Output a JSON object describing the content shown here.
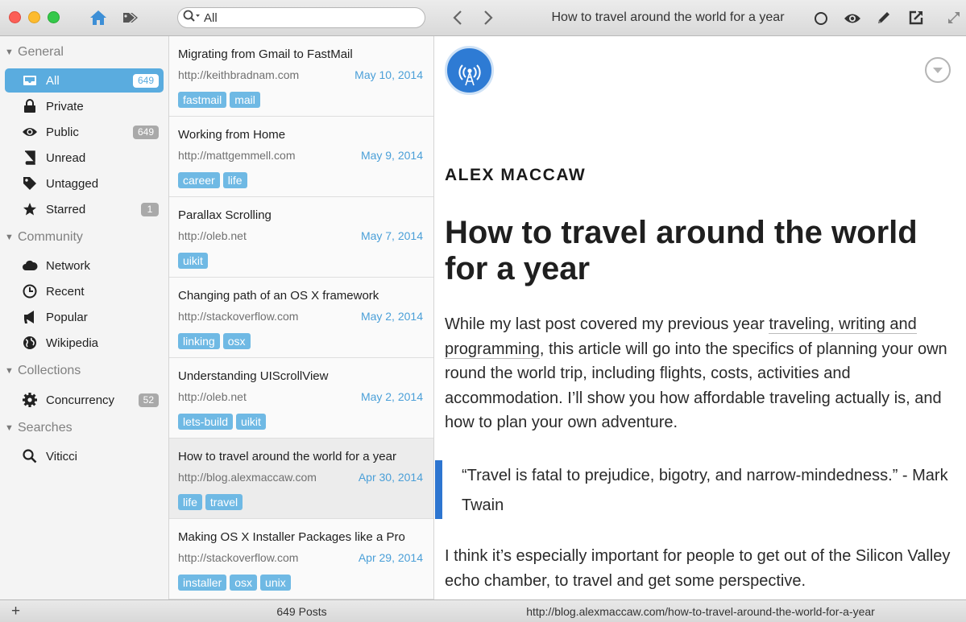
{
  "toolbar": {
    "search_placeholder": "All",
    "article_title": "How to travel around the world for a year"
  },
  "sidebar": {
    "groups": [
      {
        "label": "General"
      },
      {
        "label": "Community"
      },
      {
        "label": "Collections"
      },
      {
        "label": "Searches"
      }
    ],
    "items": [
      {
        "label": "All",
        "count": "649",
        "icon": "inbox-icon"
      },
      {
        "label": "Private",
        "count": "",
        "icon": "lock-icon"
      },
      {
        "label": "Public",
        "count": "649",
        "icon": "eye-icon"
      },
      {
        "label": "Unread",
        "count": "",
        "icon": "book-icon"
      },
      {
        "label": "Untagged",
        "count": "",
        "icon": "tag-icon"
      },
      {
        "label": "Starred",
        "count": "1",
        "icon": "star-icon"
      },
      {
        "label": "Network",
        "count": "",
        "icon": "cloud-icon"
      },
      {
        "label": "Recent",
        "count": "",
        "icon": "clock-icon"
      },
      {
        "label": "Popular",
        "count": "",
        "icon": "megaphone-icon"
      },
      {
        "label": "Wikipedia",
        "count": "",
        "icon": "globe-icon"
      },
      {
        "label": "Concurrency",
        "count": "52",
        "icon": "gear-icon"
      },
      {
        "label": "Viticci",
        "count": "",
        "icon": "search-icon"
      }
    ]
  },
  "posts": [
    {
      "title": "Migrating from Gmail to FastMail",
      "url": "http://keithbradnam.com",
      "date": "May 10, 2014",
      "tags": [
        "fastmail",
        "mail"
      ]
    },
    {
      "title": "Working from Home",
      "url": "http://mattgemmell.com",
      "date": "May 9, 2014",
      "tags": [
        "career",
        "life"
      ]
    },
    {
      "title": "Parallax Scrolling",
      "url": "http://oleb.net",
      "date": "May 7, 2014",
      "tags": [
        "uikit"
      ]
    },
    {
      "title": "Changing path of an OS X framework",
      "url": "http://stackoverflow.com",
      "date": "May 2, 2014",
      "tags": [
        "linking",
        "osx"
      ]
    },
    {
      "title": "Understanding UIScrollView",
      "url": "http://oleb.net",
      "date": "May 2, 2014",
      "tags": [
        "lets-build",
        "uikit"
      ]
    },
    {
      "title": "How to travel around the world for a year",
      "url": "http://blog.alexmaccaw.com",
      "date": "Apr 30, 2014",
      "tags": [
        "life",
        "travel"
      ]
    },
    {
      "title": "Making OS X Installer Packages like a Pro",
      "url": "http://stackoverflow.com",
      "date": "Apr 29, 2014",
      "tags": [
        "installer",
        "osx",
        "unix"
      ]
    }
  ],
  "reader": {
    "author": "ALEX MACCAW",
    "headline": "How to travel around the world for a year",
    "para1_before": "While my last post covered my previous year ",
    "para1_link": "traveling, writing and programming",
    "para1_after": ", this article will go into the specifics of planning your own round the world trip, including flights, costs, activities and accommodation. I’ll show you how affordable traveling actually is, and how to plan your own adventure.",
    "quote": "“Travel is fatal to prejudice, bigotry, and narrow-mindedness.” - Mark Twain",
    "para2": "I think it’s especially important for people to get out of the Silicon Valley echo chamber, to travel and get some perspective."
  },
  "status": {
    "plus": "+",
    "post_count": "649 Posts",
    "url": "http://blog.alexmaccaw.com/how-to-travel-around-the-world-for-a-year"
  }
}
